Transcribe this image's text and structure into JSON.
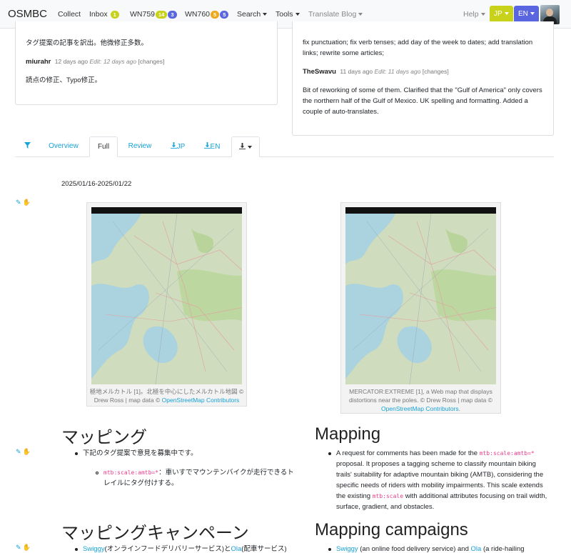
{
  "navbar": {
    "brand": "OSMBC",
    "collect": "Collect",
    "inbox": "Inbox",
    "inbox_count": "1",
    "wn759": "WN759",
    "wn759_a": "14",
    "wn759_b": "3",
    "wn760": "WN760",
    "wn760_a": "5",
    "wn760_b": "5",
    "search": "Search",
    "tools": "Tools",
    "translate_blog": "Translate Blog",
    "help": "Help",
    "lang_jp": "JP",
    "lang_en": "EN",
    "colors": {
      "jp": "#c9d21a",
      "en": "#5a66e0"
    }
  },
  "comments_left": {
    "text1": "タグ提案の記事を訳出。他微修正多数。",
    "user": "miurahr",
    "ago": "12 days ago",
    "edit": "Edit: 12 days ago",
    "changes": "[changes]",
    "text2": "読点の修正、Typo修正。"
  },
  "comments_right": {
    "text1": "fix punctuation; fix verb tenses; add day of the week to dates; add translation links; rewrite some articles;",
    "user": "TheSwavu",
    "ago": "11 days ago",
    "edit": "Edit: 11 days ago",
    "changes": "[changes]",
    "text2": "Bit of reworking of some of them. Clarified that the \"Gulf of America\" only covers the northern half of the Gulf of Mexico. UK spelling and formatting. Added a couple of auto-translates."
  },
  "tabs": {
    "overview": "Overview",
    "full": "Full",
    "review": "Review",
    "jp": "JP",
    "en": "EN"
  },
  "date_range": "2025/01/16-2025/01/22",
  "figures": {
    "left_caption_a": "極地メルカトル [",
    "left_caption_ref": "1",
    "left_caption_b": "]。北極を中心にしたメルカトル地図 © Drew Ross | map data © ",
    "left_caption_link": "OpenStreetMap Contributors",
    "right_caption_a": "MERCATOR:EXTREME [",
    "right_caption_ref": "1",
    "right_caption_b": "], a Web map that displays distortions near the poles. © Drew Ross | map data © ",
    "right_caption_link": "OpenStreetMap Contributors",
    "right_caption_end": "."
  },
  "mapping": {
    "heading_jp": "マッピング",
    "heading_en": "Mapping",
    "jp_item": "下記のタグ提案で意見を募集中です。",
    "jp_code": "mtb:scale:amtb=*",
    "jp_sub": "：車いすでマウンテンバイクが走行できるトレイルにタグ付けする。",
    "en_a": "A request for comments has been made for the ",
    "en_code": "mtb:scale:amtb=*",
    "en_b": " proposal. It proposes a tagging scheme to classify mountain biking trails' suitability for adaptive mountain biking (AMTB), considering the specific needs of riders with mobility impairments. This scale extends the existing ",
    "en_code2": "mtb:scale",
    "en_c": " with additional attributes focusing on trail width, surface, gradient, and obstacles."
  },
  "campaigns": {
    "heading_jp": "マッピングキャンペーン",
    "heading_en": "Mapping campaigns",
    "jp_link1": "Swiggy",
    "jp_a": "(オンラインフードデリバリーサービス)と",
    "jp_link2": "Ola",
    "jp_b": "(配車サービス)",
    "en_link1": "Swiggy",
    "en_a": " (an online food delivery service) and ",
    "en_link2": "Ola",
    "en_b": " (a ride-hailing"
  }
}
